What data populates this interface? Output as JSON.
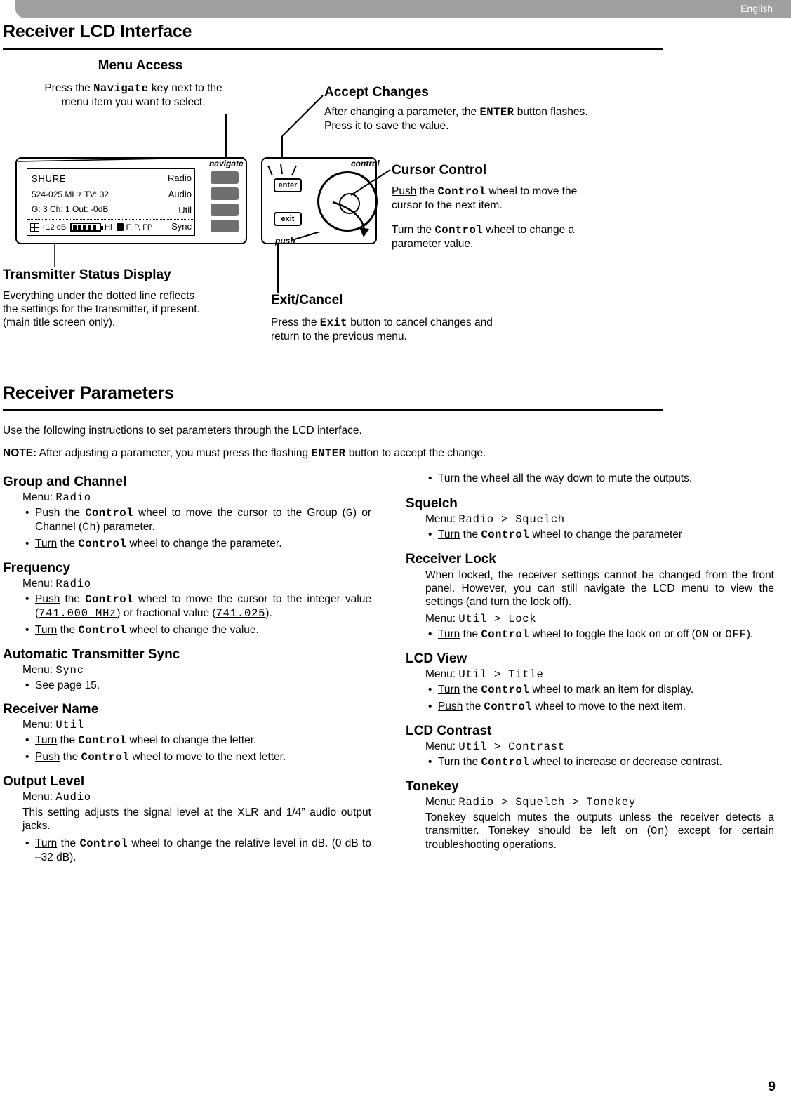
{
  "header": {
    "language": "English"
  },
  "sections": {
    "interface_title": "Receiver LCD Interface",
    "parameters_title": "Receiver Parameters"
  },
  "callouts": {
    "menu_access": {
      "title": "Menu Access",
      "line1_a": "Press the ",
      "line1_key": "Navigate",
      "line1_b": " key next to the",
      "line2": "menu item you want to select."
    },
    "accept_changes": {
      "title": "Accept Changes",
      "line1_a": "After changing a parameter, the ",
      "line1_key": "ENTER",
      "line1_b": " button flashes.",
      "line2": "Press it to save the value."
    },
    "cursor_control": {
      "title": "Cursor Control",
      "p1_a": "Push",
      "p1_b": " the ",
      "p1_key": "Control",
      "p1_c": " wheel to move the",
      "p1_d": "cursor to the next item.",
      "p2_a": "Turn",
      "p2_b": " the ",
      "p2_key": "Control",
      "p2_c": " wheel to change a",
      "p2_d": "parameter value."
    },
    "transmitter_status": {
      "title": "Transmitter Status Display",
      "line1": "Everything under the dotted line reflects",
      "line2": "the settings for the transmitter, if present.",
      "line3": "(main title screen only)."
    },
    "exit_cancel": {
      "title": "Exit/Cancel",
      "line1_a": "Press the ",
      "line1_key": "Exit",
      "line1_b": " button to cancel changes and",
      "line2": "return to the previous menu."
    }
  },
  "lcd": {
    "brand": "SHURE",
    "line2": "524-025 MHz TV: 32",
    "line3": "G: 3 Ch: 1 Out: -0dB",
    "level": "+12 dB",
    "hi": "Hi",
    "flags": "F, P, FP",
    "menu": [
      "Radio",
      "Audio",
      "Util",
      "Sync"
    ],
    "navigate_label": "navigate",
    "control_label": "control",
    "push_label": "push",
    "enter_label": "enter",
    "exit_label": "exit"
  },
  "intro": {
    "line": "Use the following instructions to set parameters through the LCD interface.",
    "note_label": "NOTE:",
    "note_a": " After adjusting a parameter, you must press the flashing ",
    "note_key": "ENTER",
    "note_b": " button to accept the change."
  },
  "left_column": [
    {
      "title": "Group and Channel",
      "menu_prefix": "Menu: ",
      "menu_value": "Radio",
      "bullets": [
        "Push the Control wheel to move the cursor to the Group (G) or Channel (Ch) parameter.",
        "Turn the Control wheel to change the parameter."
      ]
    },
    {
      "title": "Frequency",
      "menu_prefix": "Menu: ",
      "menu_value": "Radio",
      "bullets": [
        "Push the Control wheel to move the cursor to the integer value (741.000 MHz) or fractional value (741.025).",
        "Turn the Control wheel to change the value."
      ]
    },
    {
      "title": "Automatic Transmitter Sync",
      "menu_prefix": "Menu: ",
      "menu_value": "Sync",
      "bullets": [
        "See page 15."
      ]
    },
    {
      "title": "Receiver Name",
      "menu_prefix": "Menu: ",
      "menu_value": "Util",
      "bullets": [
        "Turn the Control wheel to change the letter.",
        "Push the Control wheel to move to the next letter."
      ]
    },
    {
      "title": "Output Level",
      "menu_prefix": "Menu: ",
      "menu_value": "Audio",
      "paragraph": "This setting adjusts the signal level at the XLR and 1/4” audio output jacks.",
      "bullets": [
        "Turn the Control wheel to change the relative level in dB. (0 dB to –32 dB)."
      ]
    }
  ],
  "right_column": [
    {
      "title": "",
      "bullets": [
        "Turn the wheel all the way down to mute the outputs."
      ]
    },
    {
      "title": "Squelch",
      "menu_prefix": "Menu: ",
      "menu_value": "Radio > Squelch",
      "bullets": [
        "Turn the Control wheel to change the parameter"
      ]
    },
    {
      "title": "Receiver Lock",
      "paragraph": "When locked, the receiver settings cannot be changed from the front panel. However, you can still navigate the LCD menu to view the settings (and turn the lock off).",
      "menu_prefix": "Menu: ",
      "menu_value": "Util > Lock",
      "bullets": [
        "Turn the Control wheel to toggle the lock on or off (ON or OFF)."
      ]
    },
    {
      "title": "LCD View",
      "menu_prefix": "Menu: ",
      "menu_value": "Util > Title",
      "bullets": [
        "Turn the Control wheel to mark an item for display.",
        "Push the Control wheel to move to the next item."
      ]
    },
    {
      "title": "LCD Contrast",
      "menu_prefix": "Menu: ",
      "menu_value": "Util > Contrast",
      "bullets": [
        "Turn the Control wheel to increase or decrease contrast."
      ]
    },
    {
      "title": "Tonekey",
      "menu_prefix": "Menu: ",
      "menu_value": "Radio > Squelch > Tonekey",
      "paragraph": "Tonekey squelch mutes the outputs unless the receiver detects a transmitter. Tonekey should be left on (On) except for certain troubleshooting operations."
    }
  ],
  "footer": {
    "page": "9"
  }
}
